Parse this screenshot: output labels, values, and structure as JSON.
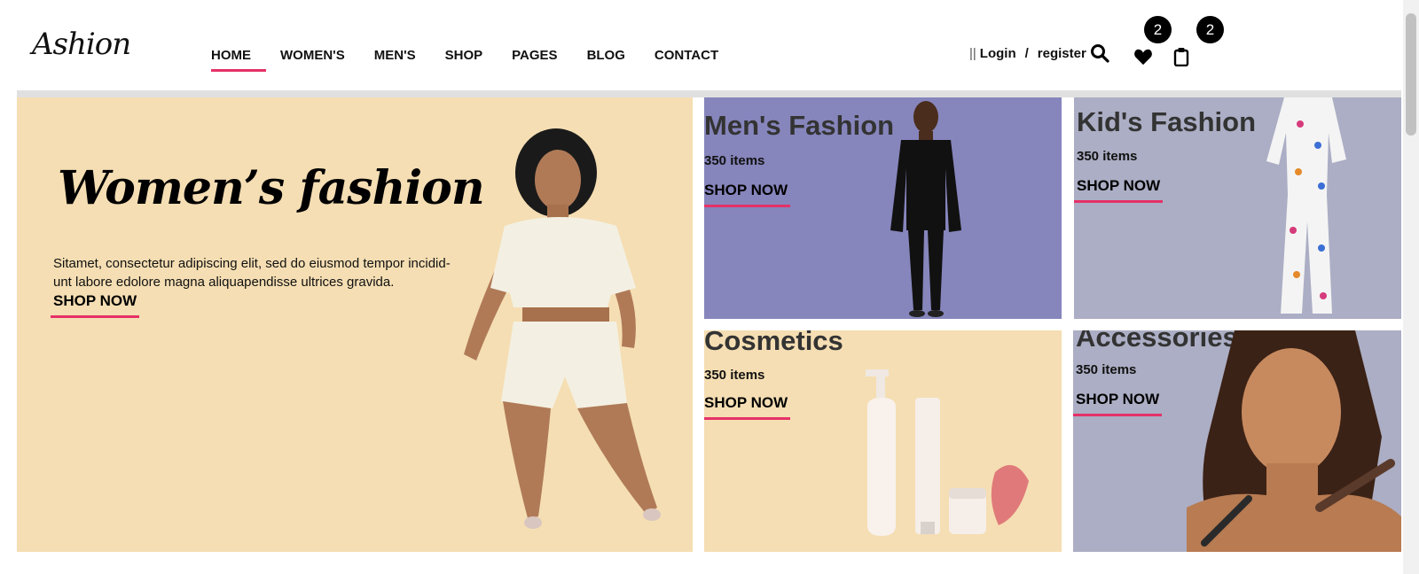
{
  "brand": {
    "logo_text": "Ashion"
  },
  "nav": {
    "items": [
      {
        "label": "HOME",
        "active": true
      },
      {
        "label": "WOMEN'S"
      },
      {
        "label": "MEN'S"
      },
      {
        "label": "SHOP"
      },
      {
        "label": "PAGES"
      },
      {
        "label": "BLOG"
      },
      {
        "label": "CONTACT"
      }
    ]
  },
  "header_actions": {
    "separator": "||",
    "login_label": "Login",
    "slash": "/",
    "register_label": "register",
    "wishlist_count": "2",
    "cart_count": "2",
    "icons": [
      "search-icon",
      "heart-icon",
      "clipboard-icon"
    ]
  },
  "hero": {
    "title": "Women’s fashion",
    "description": "Sitamet, consectetur adipiscing elit, sed do eiusmod tempor incidid-unt labore edolore magna aliquapendisse ultrices gravida.",
    "cta": "SHOP NOW"
  },
  "categories": [
    {
      "title": "Men's Fashion",
      "count": "350 items",
      "cta": "SHOP NOW"
    },
    {
      "title": "Kid's Fashion",
      "count": "350 items",
      "cta": "SHOP NOW"
    },
    {
      "title": "Cosmetics",
      "count": "350 items",
      "cta": "SHOP NOW"
    },
    {
      "title": "Accessories",
      "count": "350 items",
      "cta": "SHOP NOW"
    }
  ],
  "colors": {
    "accent": "#e53167",
    "hero_bg": "#f5deb3",
    "men_bg": "#8685bc",
    "kids_bg": "#abaec4",
    "cosmetics_bg": "#f5deb3",
    "accessories_bg": "#abaec4"
  }
}
